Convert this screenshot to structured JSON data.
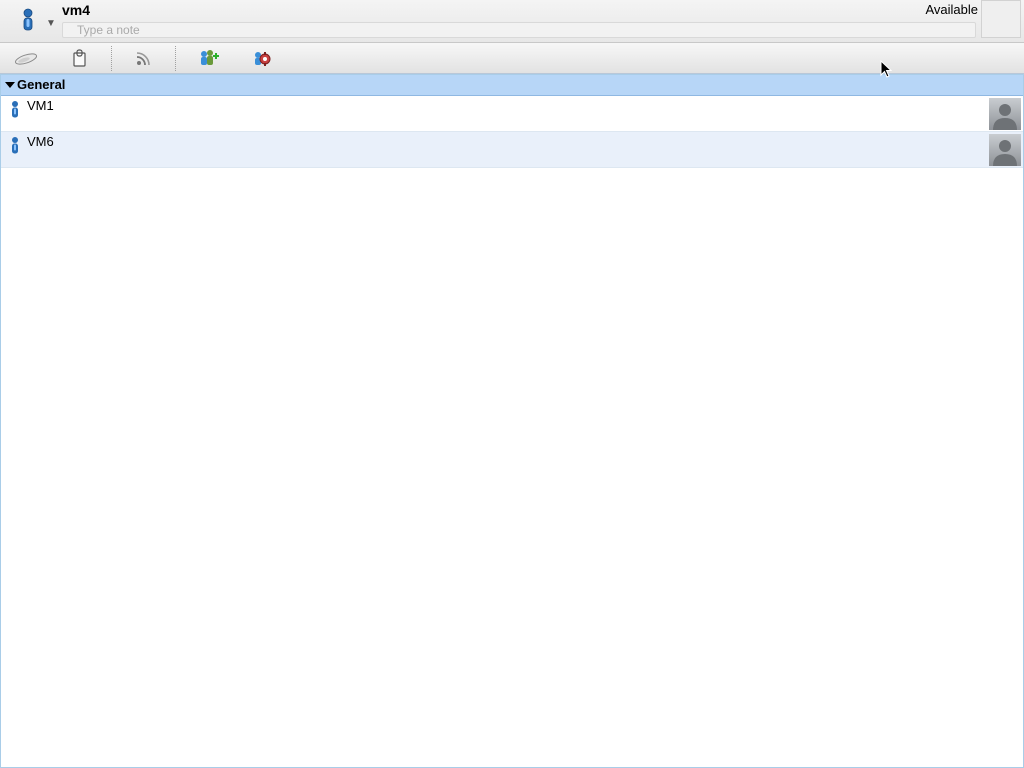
{
  "header": {
    "username": "vm4",
    "note_placeholder": "Type a note",
    "note_value": "",
    "status": "Available",
    "status_icon": "user-presence-icon",
    "status_dropdown_icon": "chevron-down-icon"
  },
  "toolbar": {
    "buttons": [
      {
        "name": "cloud-icon"
      },
      {
        "name": "clipboard-icon"
      },
      {
        "name": "rss-feed-icon"
      },
      {
        "name": "add-contact-icon"
      },
      {
        "name": "settings-gear-icon"
      }
    ]
  },
  "contacts": {
    "groups": [
      {
        "name": "General",
        "expanded": true,
        "members": [
          {
            "name": "VM1",
            "icon": "user-presence-icon",
            "avatar": "default-avatar-icon"
          },
          {
            "name": "VM6",
            "icon": "user-presence-icon",
            "avatar": "default-avatar-icon"
          }
        ]
      }
    ]
  },
  "colors": {
    "group_header_bg": "#b7d6f7",
    "alt_row_bg": "#e9f0fa",
    "presence_blue": "#2a6fb8"
  }
}
